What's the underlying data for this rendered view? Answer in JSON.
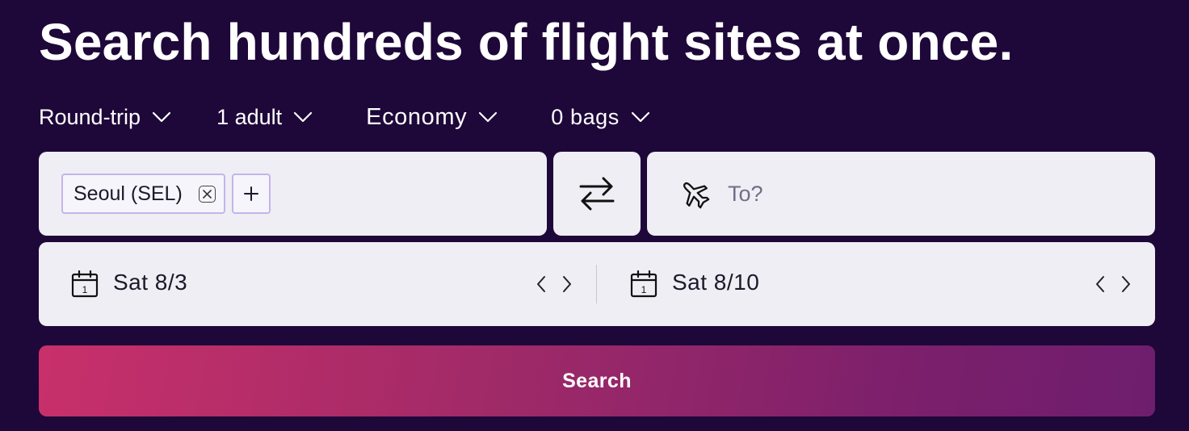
{
  "headline": "Search hundreds of flight sites at once.",
  "options": {
    "trip_type": "Round-trip",
    "passengers": "1 adult",
    "cabin": "Economy",
    "bags": "0 bags"
  },
  "origin": {
    "chip_label": "Seoul (SEL)",
    "add_label": "+"
  },
  "destination": {
    "placeholder": "To?",
    "value": ""
  },
  "dates": {
    "depart": "Sat 8/3",
    "return": "Sat 8/10",
    "calendar_day": "1"
  },
  "search_button": "Search",
  "colors": {
    "background": "#1e0739",
    "field_bg": "#efeef4",
    "chip_border": "#c4b5ea",
    "button_gradient_start": "#c8306a",
    "button_gradient_end": "#6e1e6e"
  },
  "icons": [
    "chevron-down-icon",
    "close-icon",
    "plus-icon",
    "swap-icon",
    "plane-icon",
    "calendar-icon",
    "chevron-left-icon",
    "chevron-right-icon"
  ]
}
